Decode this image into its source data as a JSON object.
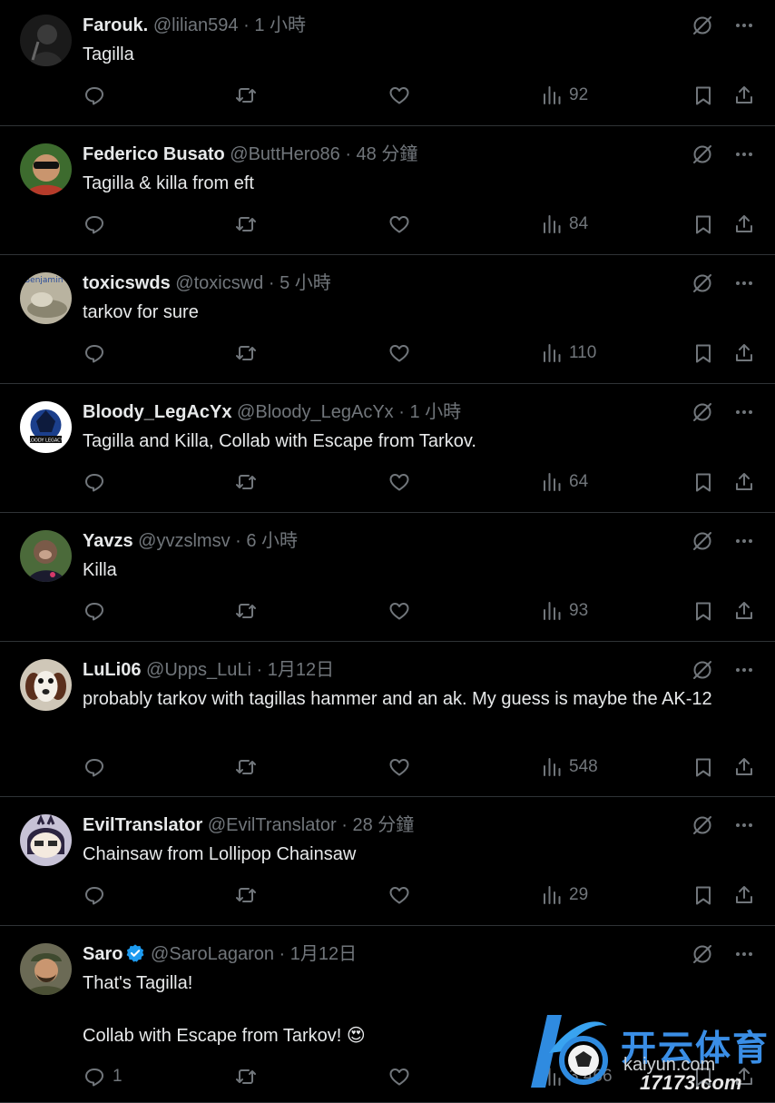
{
  "colors": {
    "bg": "#000000",
    "text": "#e7e9ea",
    "muted": "#71767b",
    "divider": "#2f3336",
    "verified": "#1d9bf0",
    "watermark": "#3a8ee6"
  },
  "icons": {
    "grok": "grok-icon",
    "more": "more-icon",
    "reply": "reply-icon",
    "retweet": "retweet-icon",
    "like": "like-icon",
    "views": "views-icon",
    "bookmark": "bookmark-icon",
    "share": "share-icon"
  },
  "posts": [
    {
      "name": "Farouk.",
      "handle": "@lilian594",
      "sep": "·",
      "time": "1 小時",
      "text": "Tagilla",
      "replies": "",
      "views": "92"
    },
    {
      "name": "Federico Busato",
      "handle": "@ButtHero86",
      "sep": "·",
      "time": "48 分鐘",
      "text": "Tagilla & killa from eft",
      "replies": "",
      "views": "84"
    },
    {
      "name": "toxicswds",
      "handle": "@toxicswd",
      "sep": "·",
      "time": "5 小時",
      "text": "tarkov for sure",
      "replies": "",
      "views": "110",
      "avatar_text": "Benjamin"
    },
    {
      "name": "Bloody_LegAcYx",
      "handle": "@Bloody_LegAcYx",
      "sep": "·",
      "time": "1 小時",
      "text": "Tagilla and Killa, Collab with Escape from Tarkov.",
      "replies": "",
      "views": "64",
      "avatar_text": "BLOODY LEGACYX"
    },
    {
      "name": "Yavzs",
      "handle": "@yvzslmsv",
      "sep": "·",
      "time": "6 小時",
      "text": "Killa",
      "replies": "",
      "views": "93"
    },
    {
      "name": "LuLi06",
      "handle": "@Upps_LuLi",
      "sep": "·",
      "time": "1月12日",
      "text": "probably tarkov with tagillas hammer and an ak. My guess is maybe the AK-12",
      "replies": "",
      "views": "548"
    },
    {
      "name": "EvilTranslator",
      "handle": "@EvilTranslator",
      "sep": "·",
      "time": "28 分鐘",
      "text": "Chainsaw from Lollipop Chainsaw",
      "replies": "",
      "views": "29"
    },
    {
      "name": "Saro",
      "handle": "@SaroLagaron",
      "sep": "·",
      "time": "1月12日",
      "text": "That's Tagilla!\n\nCollab with Escape from Tarkov! 😍",
      "replies": "1",
      "views": "3,466",
      "verified": true
    }
  ],
  "watermark": {
    "brand_cn": "开云体育",
    "url": "kaiyun.com",
    "site": "17173.com"
  }
}
